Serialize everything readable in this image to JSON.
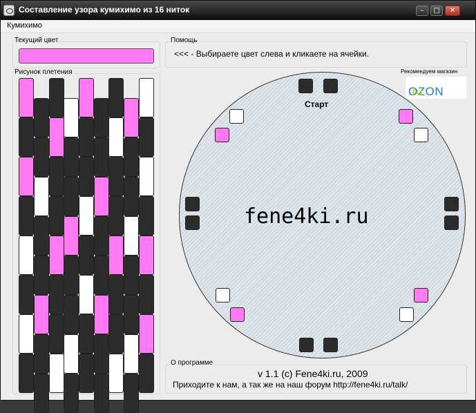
{
  "window": {
    "title": "Составление узора кумихимо из 16 ниток"
  },
  "menu": [
    "Кумихимо"
  ],
  "current_color": {
    "label": "Текущий цвет",
    "value": "#ff7af2"
  },
  "help": {
    "label": "Помощь",
    "text": "<<< - Выбираете цвет слева и кликаете на ячейки."
  },
  "pattern": {
    "label": "Рисунок плетения",
    "colors": {
      "pink": "#ff7af2",
      "black": "#2c2c2c",
      "white": "#ffffff"
    },
    "strips": [
      [
        "pink",
        "black",
        "pink",
        "black",
        "white",
        "black",
        "white",
        "black"
      ],
      [
        "black",
        "black",
        "white",
        "black",
        "black",
        "pink",
        "black",
        "black"
      ],
      [
        "black",
        "pink",
        "black",
        "black",
        "pink",
        "black",
        "black",
        "white"
      ],
      [
        "white",
        "black",
        "black",
        "pink",
        "black",
        "black",
        "white",
        "black"
      ],
      [
        "pink",
        "black",
        "black",
        "white",
        "black",
        "white",
        "black",
        "black"
      ],
      [
        "black",
        "black",
        "pink",
        "black",
        "black",
        "pink",
        "black",
        "black"
      ],
      [
        "black",
        "white",
        "black",
        "black",
        "pink",
        "black",
        "black",
        "white"
      ],
      [
        "pink",
        "black",
        "black",
        "white",
        "black",
        "black",
        "white",
        "black"
      ],
      [
        "white",
        "black",
        "white",
        "black",
        "pink",
        "black",
        "pink",
        "black"
      ]
    ]
  },
  "disk": {
    "start_label": "Старт",
    "brand": "fene4ki.ru",
    "slots": [
      "black",
      "black",
      "pink",
      "white",
      "white",
      "pink",
      "black",
      "black",
      "black",
      "black",
      "white",
      "pink",
      "pink",
      "white",
      "black",
      "black"
    ]
  },
  "shop": {
    "label": "Рекомендуем магазин",
    "logo": "OZON.ru"
  },
  "about": {
    "label": "О программе",
    "version": "v 1.1 (c) Fene4ki.ru, 2009",
    "forum": "Приходите к нам, а так же на наш форум http://fene4ki.ru/talk/"
  }
}
